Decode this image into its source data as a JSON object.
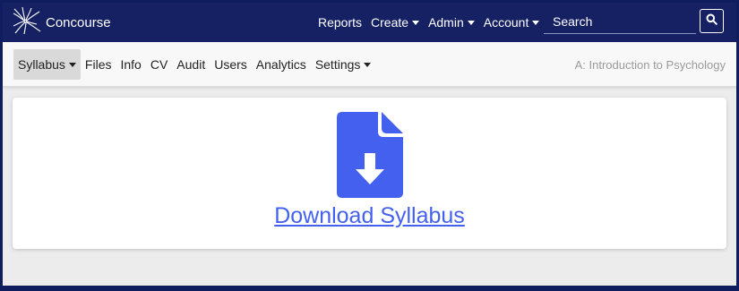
{
  "brand": {
    "name": "Concourse",
    "logo_icon": "concourse-logo-icon"
  },
  "topnav": {
    "items": [
      {
        "label": "Reports",
        "dropdown": false
      },
      {
        "label": "Create",
        "dropdown": true
      },
      {
        "label": "Admin",
        "dropdown": true
      },
      {
        "label": "Account",
        "dropdown": true
      }
    ]
  },
  "search": {
    "placeholder": "Search",
    "value": "",
    "button_icon": "search-icon"
  },
  "subnav": {
    "items": [
      {
        "label": "Syllabus",
        "dropdown": true,
        "active": true
      },
      {
        "label": "Files",
        "dropdown": false
      },
      {
        "label": "Info",
        "dropdown": false
      },
      {
        "label": "CV",
        "dropdown": false
      },
      {
        "label": "Audit",
        "dropdown": false
      },
      {
        "label": "Users",
        "dropdown": false
      },
      {
        "label": "Analytics",
        "dropdown": false
      },
      {
        "label": "Settings",
        "dropdown": true
      }
    ],
    "course_title": "A: Introduction to Psychology"
  },
  "main": {
    "download_label": "Download Syllabus",
    "download_icon": "file-download-icon"
  },
  "colors": {
    "navbar": "#152163",
    "accent": "#4361ee",
    "page_bg": "#ececec"
  }
}
